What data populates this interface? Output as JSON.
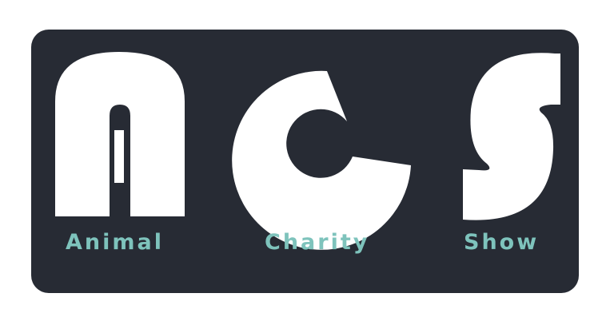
{
  "logo": {
    "monogram": "ACS",
    "words": [
      "Animal",
      "Charity",
      "Show"
    ],
    "colors": {
      "background": "#ffffff",
      "panel": "#272b34",
      "letters": "#ffffff",
      "caption": "#7ec3bc"
    }
  }
}
